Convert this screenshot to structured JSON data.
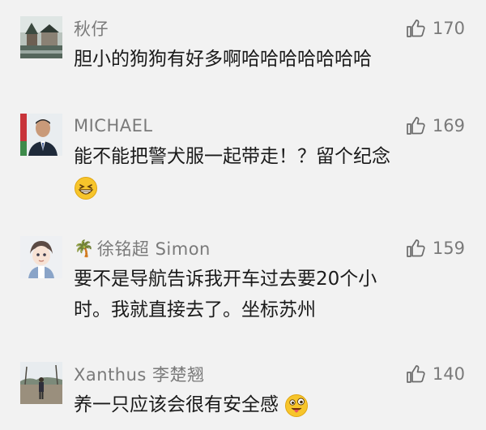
{
  "comments": [
    {
      "name": "秋仔",
      "likes": "170",
      "text": "胆小的狗狗有好多啊哈哈哈哈哈哈哈",
      "avatar_icon": "village-photo-avatar"
    },
    {
      "name": "MICHAEL",
      "likes": "169",
      "text": "能不能把警犬服一起带走！？留个纪念",
      "emoji_icon": "grinning-squint-emoji",
      "avatar_icon": "man-in-suit-avatar"
    },
    {
      "name_prefix_icon": "🌴",
      "name": "徐铭超 Simon",
      "likes": "159",
      "text_line1": "要不是导航告诉我开车过去要20个小",
      "text_line2": "时。我就直接去了。坐标苏州",
      "avatar_icon": "cartoon-boy-avatar"
    },
    {
      "name": "Xanthus 李楚翘",
      "likes": "140",
      "text": "养一只应该会很有安全感",
      "emoji_icon": "tongue-out-emoji",
      "avatar_icon": "person-outdoors-avatar"
    }
  ],
  "colors": {
    "background": "#f2f2f2",
    "name": "#7a7a7a",
    "text": "#1a1a1a",
    "like_icon": "#6b6b6b"
  }
}
